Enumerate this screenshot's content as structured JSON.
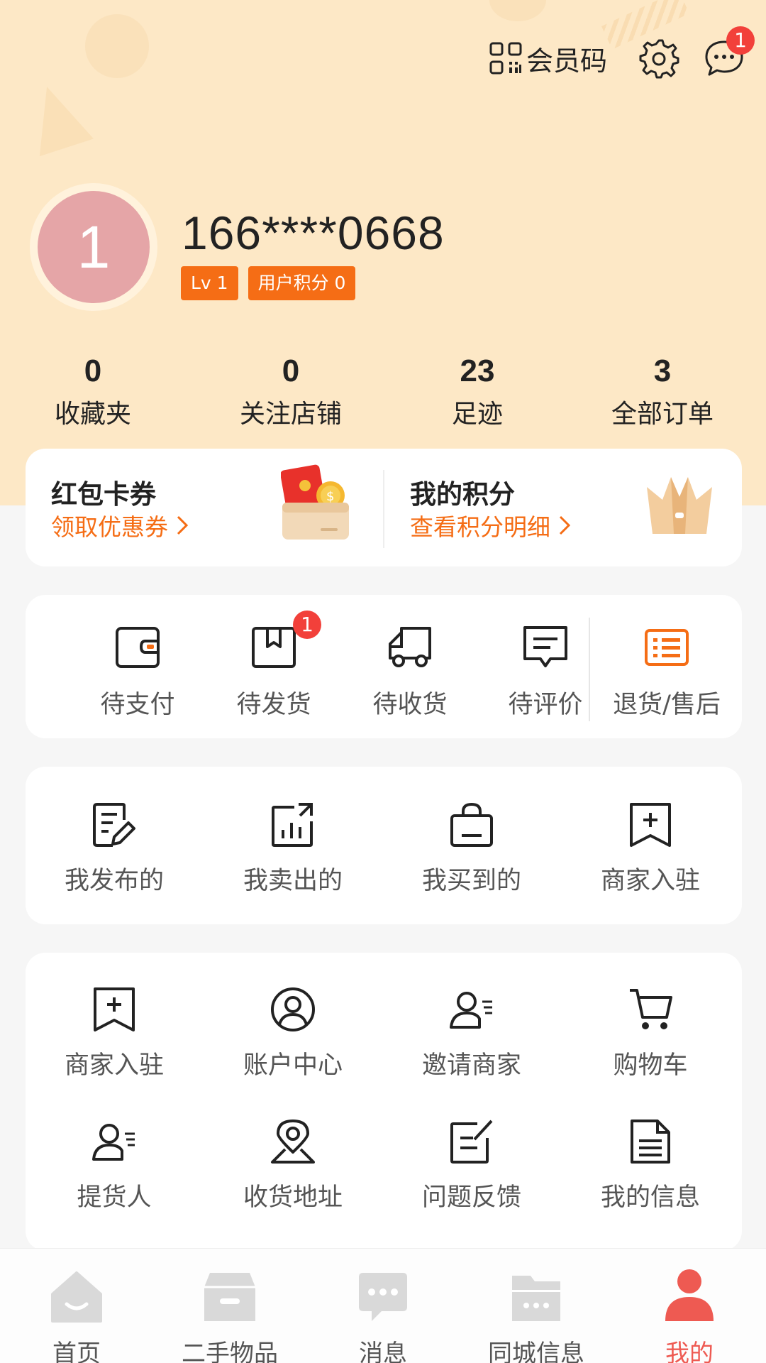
{
  "header": {
    "member_code_label": "会员码",
    "message_badge": "1"
  },
  "profile": {
    "avatar_text": "1",
    "phone": "166****0668",
    "level": "Lv 1",
    "points_tag": "用户积分 0"
  },
  "stats": [
    {
      "value": "0",
      "label": "收藏夹"
    },
    {
      "value": "0",
      "label": "关注店铺"
    },
    {
      "value": "23",
      "label": "足迹"
    },
    {
      "value": "3",
      "label": "全部订单"
    }
  ],
  "promo": {
    "coupon": {
      "title": "红包卡券",
      "link": "领取优惠券"
    },
    "points": {
      "title": "我的积分",
      "link": "查看积分明细"
    }
  },
  "orders": [
    {
      "label": "待支付",
      "icon": "wallet-icon"
    },
    {
      "label": "待发货",
      "icon": "package-icon",
      "badge": "1"
    },
    {
      "label": "待收货",
      "icon": "truck-icon"
    },
    {
      "label": "待评价",
      "icon": "comment-icon"
    },
    {
      "label": "退货/售后",
      "icon": "return-list-icon"
    }
  ],
  "publish": [
    {
      "label": "我发布的",
      "icon": "edit-note-icon"
    },
    {
      "label": "我卖出的",
      "icon": "chart-export-icon"
    },
    {
      "label": "我买到的",
      "icon": "shopping-bag-icon"
    },
    {
      "label": "商家入驻",
      "icon": "bookmark-plus-icon"
    }
  ],
  "services": [
    {
      "label": "商家入驻",
      "icon": "bookmark-plus-icon"
    },
    {
      "label": "账户中心",
      "icon": "user-circle-icon"
    },
    {
      "label": "邀请商家",
      "icon": "user-invite-icon"
    },
    {
      "label": "购物车",
      "icon": "cart-icon"
    },
    {
      "label": "提货人",
      "icon": "user-list-icon"
    },
    {
      "label": "收货地址",
      "icon": "location-pin-icon"
    },
    {
      "label": "问题反馈",
      "icon": "feedback-icon"
    },
    {
      "label": "我的信息",
      "icon": "document-icon"
    }
  ],
  "tabs": [
    {
      "label": "首页",
      "icon": "home-icon"
    },
    {
      "label": "二手物品",
      "icon": "box-icon"
    },
    {
      "label": "消息",
      "icon": "chat-icon"
    },
    {
      "label": "同城信息",
      "icon": "folder-icon"
    },
    {
      "label": "我的",
      "icon": "person-icon",
      "active": true
    }
  ],
  "colors": {
    "hero_bg": "#fde8c6",
    "accent_orange": "#f56d15",
    "badge_red": "#f2403a",
    "active_tab": "#ee5a52",
    "avatar_bg": "#e5a5a7"
  }
}
